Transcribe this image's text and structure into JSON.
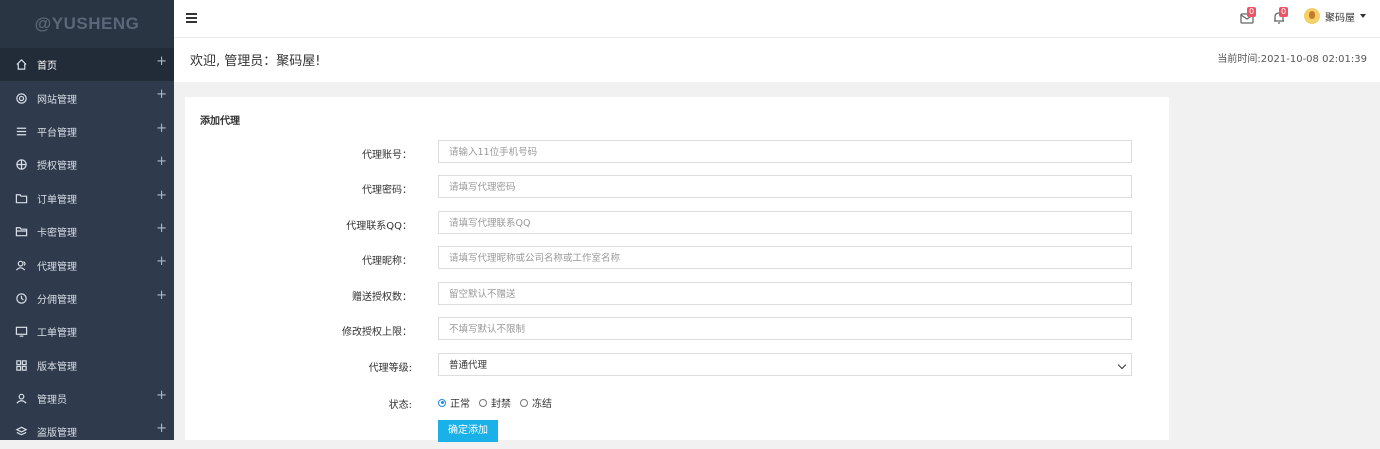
{
  "brand": "@YUSHENG",
  "sidebar": {
    "items": [
      {
        "label": "首页",
        "icon": "home-icon",
        "expandable": true
      },
      {
        "label": "网站管理",
        "icon": "gear-icon",
        "expandable": true
      },
      {
        "label": "平台管理",
        "icon": "list-icon",
        "expandable": true
      },
      {
        "label": "授权管理",
        "icon": "basketball-icon",
        "expandable": true
      },
      {
        "label": "订单管理",
        "icon": "folder-icon",
        "expandable": true
      },
      {
        "label": "卡密管理",
        "icon": "folder-open-icon",
        "expandable": true
      },
      {
        "label": "代理管理",
        "icon": "users-icon",
        "expandable": true
      },
      {
        "label": "分佣管理",
        "icon": "clock-icon",
        "expandable": true
      },
      {
        "label": "工单管理",
        "icon": "monitor-icon",
        "expandable": false
      },
      {
        "label": "版本管理",
        "icon": "grid-icon",
        "expandable": false
      },
      {
        "label": "管理员",
        "icon": "user-icon",
        "expandable": true
      },
      {
        "label": "盗版管理",
        "icon": "layers-icon",
        "expandable": true
      }
    ],
    "plus": "+"
  },
  "topbar": {
    "mail_badge": "0",
    "bell_badge": "0",
    "username": "聚码屋"
  },
  "welcome": {
    "greeting": "欢迎, 管理员：聚码屋!",
    "time": "当前时间:2021-10-08 02:01:39"
  },
  "form": {
    "title": "添加代理",
    "fields": [
      {
        "label": "代理账号：",
        "placeholder": "请输入11位手机号码"
      },
      {
        "label": "代理密码：",
        "placeholder": "请填写代理密码"
      },
      {
        "label": "代理联系QQ：",
        "placeholder": "请填写代理联系QQ"
      },
      {
        "label": "代理昵称：",
        "placeholder": "请填写代理昵称或公司名称或工作室名称"
      },
      {
        "label": "赠送授权数：",
        "placeholder": "留空默认不赠送"
      },
      {
        "label": "修改授权上限：",
        "placeholder": "不填写默认不限制"
      }
    ],
    "level": {
      "label": "代理等级:",
      "value": "普通代理"
    },
    "status": {
      "label": "状态:",
      "options": [
        "正常",
        "封禁",
        "冻结"
      ],
      "selected": "正常"
    },
    "submit": "确定添加"
  }
}
